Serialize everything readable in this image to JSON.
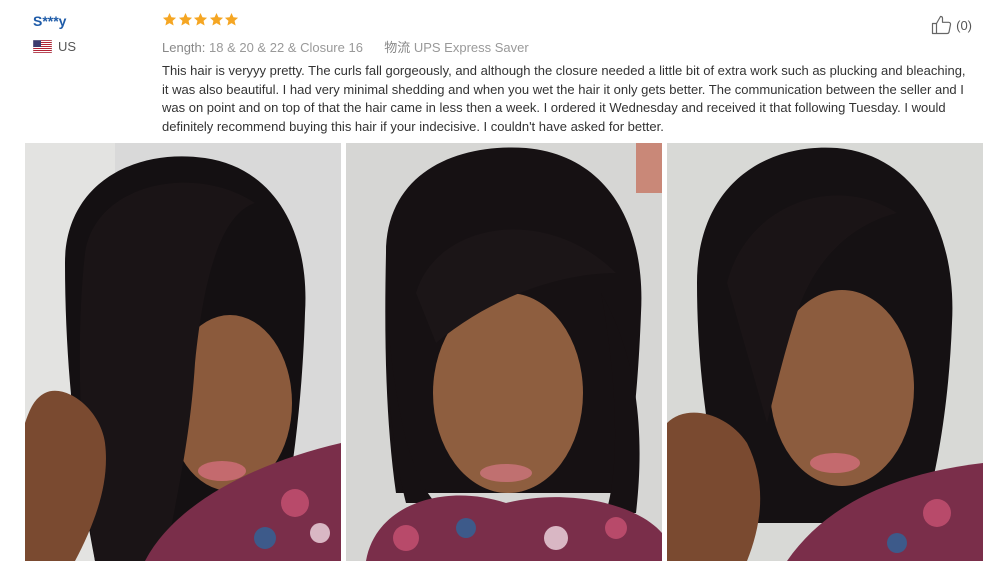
{
  "review": {
    "reviewer_name": "S***y",
    "country": "US",
    "rating": 5,
    "length_label": "Length:",
    "length_value": "18 & 20 & 22 & Closure 16",
    "shipping_label": "物流",
    "shipping_value": "UPS Express Saver",
    "text": "This hair is veryyy pretty. The curls fall gorgeously, and although the closure needed a little bit of extra work such as plucking and bleaching, it was also beautiful. I had very minimal shedding and when you wet the hair it only gets better. The communication between the seller and I was on point and on top of that the hair came in less then a week. I ordered it Wednesday and received it that following Tuesday. I would definitely recommend buying this hair if your indecisive. I couldn't have asked for better.",
    "helpful_count": "(0)"
  },
  "icons": {
    "flag": "us-flag-icon",
    "star": "star-icon",
    "helpful": "thumbs-up-icon"
  },
  "colors": {
    "name": "#1e5ba8",
    "star": "#f5a623",
    "muted": "#999999",
    "text": "#333333"
  }
}
